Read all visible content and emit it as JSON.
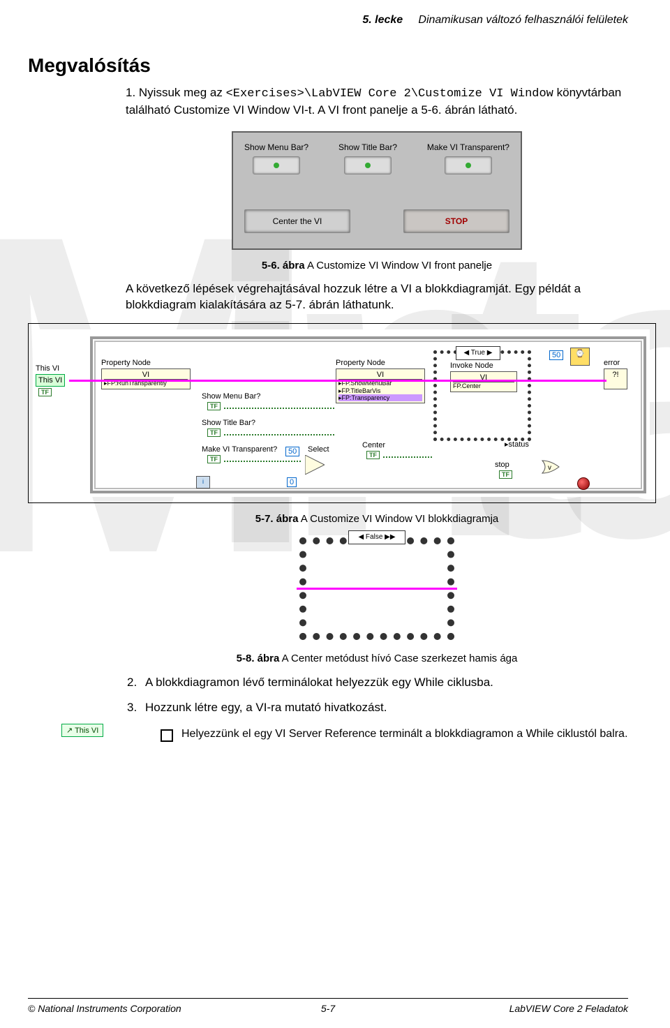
{
  "header": {
    "lesson": "5. lecke",
    "title": "Dinamikusan változó felhasználói felületek"
  },
  "section_title": "Megvalósítás",
  "step1": {
    "pre": "1.  Nyissuk meg az ",
    "code": "<Exercises>\\LabVIEW Core 2\\Customize VI Window",
    "post": " könyvtárban található Customize VI Window VI-t. A VI front panelje a 5-6. ábrán látható."
  },
  "fp": {
    "showMenu": "Show Menu Bar?",
    "showTitle": "Show Title Bar?",
    "makeTrans": "Make VI Transparent?",
    "center": "Center the VI",
    "stop": "STOP"
  },
  "cap56": {
    "bold": "5-6. ábra",
    "rest": "  A Customize VI Window VI front panelje"
  },
  "para_after56": "A következő lépések végrehajtásával hozzuk létre a VI a blokkdiagramját. Egy példát a blokkdiagram kialakítására az 5-7. ábrán láthatunk.",
  "bd": {
    "thisvi": "This VI",
    "thisvi_box": "This VI",
    "propnode": "Property Node",
    "vi": "VI",
    "fpRun": "FP:RunTransparently",
    "showMenu": "Show Menu Bar?",
    "showTitle": "Show Title Bar?",
    "makeTrans": "Make VI Transparent?",
    "fpShowMenu": "FP.ShowMenuBar",
    "fpTitle": "FP.TitleBarVis",
    "fpTransp": "FP:Transparency",
    "invnode": "Invoke Node",
    "fpCenter": "FP.Center",
    "trueSel": "◀ True ▶",
    "falseSel": "◀ False ▶▶",
    "fifty": "50",
    "zero": "0",
    "select": "Select",
    "center": "Center",
    "status": "status",
    "stop": "stop",
    "error": "error",
    "iterm": "i",
    "tf": "TF"
  },
  "cap57": {
    "bold": "5-7. ábra",
    "rest": "  A Customize VI Window VI blokkdiagramja"
  },
  "cap58": {
    "bold": "5-8. ábra",
    "rest": "  A Center metódust hívó Case szerkezet hamis ága"
  },
  "step2": "A blokkdiagramon lévő terminálokat helyezzük egy While ciklusba.",
  "step3": "Hozzunk létre egy, a VI-ra mutató hivatkozást.",
  "bullet1": "Helyezzünk el egy VI Server Reference terminált a blokkdiagramon a While ciklustól balra.",
  "thisvi_badge": "↗ This VI",
  "footer": {
    "left": "© National Instruments Corporation",
    "center": "5-7",
    "right": "LabVIEW Core 2 Feladatok"
  }
}
